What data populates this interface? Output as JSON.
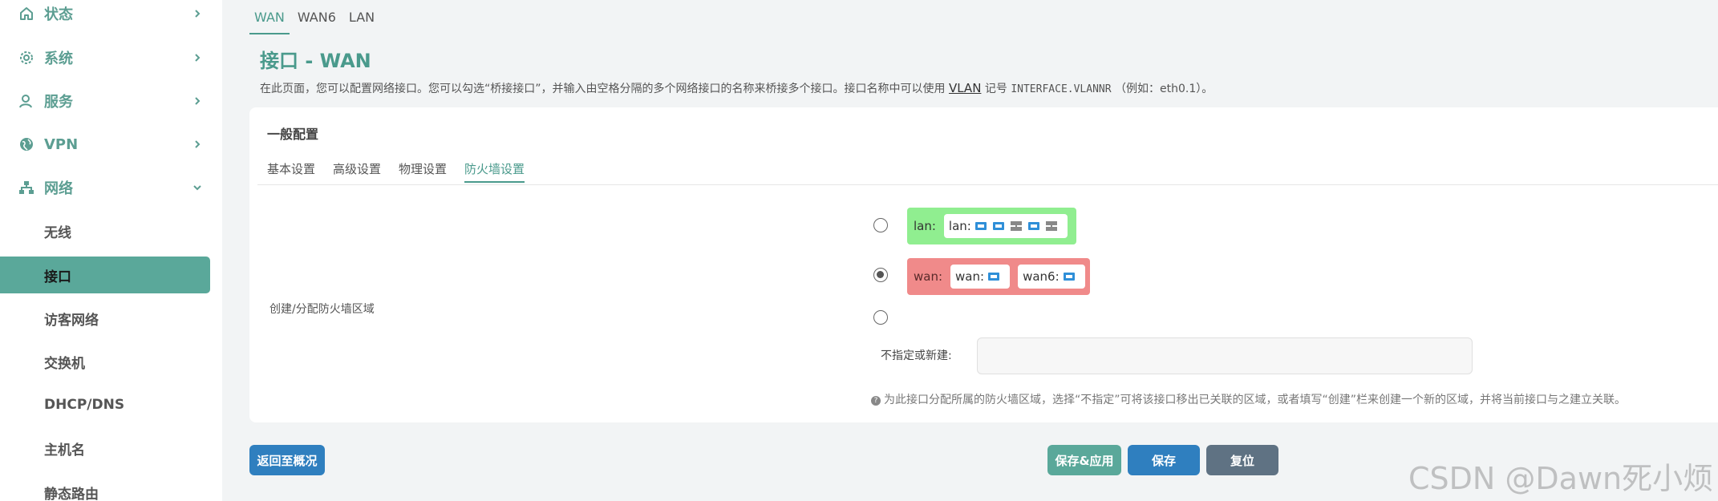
{
  "sidebar": {
    "menu": [
      {
        "label": "状态",
        "icon": "home-icon",
        "arrow": "chevron-right-icon"
      },
      {
        "label": "系统",
        "icon": "gear-icon",
        "arrow": "chevron-right-icon"
      },
      {
        "label": "服务",
        "icon": "user-icon",
        "arrow": "chevron-right-icon"
      },
      {
        "label": "VPN",
        "icon": "globe-icon",
        "arrow": "chevron-right-icon"
      },
      {
        "label": "网络",
        "icon": "network-icon",
        "arrow": "chevron-down-icon"
      }
    ],
    "submenu": [
      {
        "label": "无线"
      },
      {
        "label": "接口"
      },
      {
        "label": "访客网络"
      },
      {
        "label": "交换机"
      },
      {
        "label": "DHCP/DNS"
      },
      {
        "label": "主机名"
      },
      {
        "label": "静态路由"
      }
    ]
  },
  "top_tabs": [
    {
      "label": "WAN"
    },
    {
      "label": "WAN6"
    },
    {
      "label": "LAN"
    }
  ],
  "page": {
    "title": "接口 - WAN",
    "desc_before": "在此页面，您可以配置网络接口。您可以勾选“桥接接口”，并输入由空格分隔的多个网络接口的名称来桥接多个接口。接口名称中可以使用",
    "desc_vlan": "VLAN",
    "desc_middle": "记号",
    "desc_code": "INTERFACE.VLANNR",
    "desc_after": "（例如：eth0.1）。"
  },
  "panel": {
    "section_title": "一般配置",
    "sub_tabs": [
      {
        "label": "基本设置"
      },
      {
        "label": "高级设置"
      },
      {
        "label": "物理设置"
      },
      {
        "label": "防火墙设置"
      }
    ],
    "field_label": "创建/分配防火墙区域",
    "zones": [
      {
        "name": "lan:",
        "color": "#90ee90",
        "ifaces": [
          {
            "name": "lan:",
            "icons": [
              "ethernet-icon",
              "ethernet-icon",
              "switch-icon",
              "ethernet-icon",
              "switch-icon"
            ]
          }
        ]
      },
      {
        "name": "wan:",
        "color": "#f08a8a",
        "ifaces": [
          {
            "name": "wan:",
            "icons": [
              "ethernet-icon"
            ]
          },
          {
            "name": "wan6:",
            "icons": [
              "ethernet-icon"
            ]
          }
        ]
      }
    ],
    "new_zone_label": "不指定或新建:",
    "help": "为此接口分配所属的防火墙区域，选择“不指定”可将该接口移出已关联的区域，或者填写“创建”栏来创建一个新的区域，并将当前接口与之建立关联。"
  },
  "buttons": {
    "back": "返回至概况",
    "save_apply": "保存&应用",
    "save": "保存",
    "reset": "复位"
  },
  "watermark": "CSDN @Dawn死小烦",
  "colors": {
    "accent": "#4a9a8c",
    "active_bg": "#5aa89a",
    "primary_button": "#2f7fbf",
    "reset_button": "#5f7283",
    "lan_zone": "#90ee90",
    "wan_zone": "#f08a8a"
  }
}
